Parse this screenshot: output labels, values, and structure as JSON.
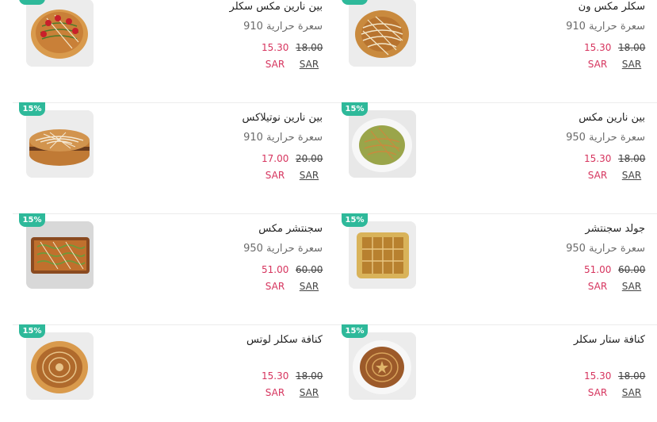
{
  "currency": "SAR",
  "discount_badge": "15%",
  "colors": {
    "badge": "#2eb99a",
    "sale_price": "#d6345e"
  },
  "items": [
    {
      "name": "سكلر مكس ون",
      "calories": "سعرة حرارية 910",
      "old_price": "18.00",
      "new_price": "15.30",
      "icon": "dessert-pie-image"
    },
    {
      "name": "بين نارين مكس سكلر",
      "calories": "سعرة حرارية 910",
      "old_price": "18.00",
      "new_price": "15.30",
      "icon": "strawberry-cake-image"
    },
    {
      "name": "بين نارين مكس",
      "calories": "سعرة حرارية 950",
      "old_price": "18.00",
      "new_price": "15.30",
      "icon": "pistachio-pie-image"
    },
    {
      "name": "بين نارين نوتيلاكس",
      "calories": "سعرة حرارية 910",
      "old_price": "20.00",
      "new_price": "17.00",
      "icon": "nutella-cake-image"
    },
    {
      "name": "جولد سجنتشر",
      "calories": "سعرة حرارية 950",
      "old_price": "60.00",
      "new_price": "51.00",
      "icon": "gold-tray-image"
    },
    {
      "name": "سجنتشر مكس",
      "calories": "سعرة حرارية 950",
      "old_price": "60.00",
      "new_price": "51.00",
      "icon": "signature-tray-image"
    },
    {
      "name": "كنافة ستار سكلر",
      "calories": "",
      "old_price": "18.00",
      "new_price": "15.30",
      "icon": "kunafa-star-image"
    },
    {
      "name": "كنافة سكلر لوتس",
      "calories": "",
      "old_price": "18.00",
      "new_price": "15.30",
      "icon": "kunafa-lotus-image"
    }
  ]
}
